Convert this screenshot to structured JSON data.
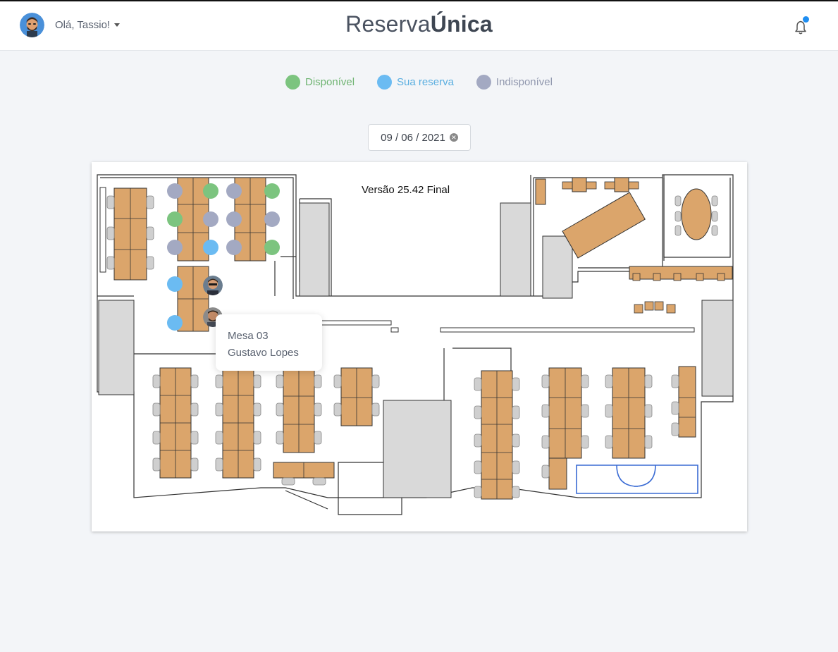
{
  "header": {
    "greeting": "Olá, Tassio!",
    "brand_regular": "Reserva",
    "brand_bold": "Única",
    "notification_icon": "bell-icon"
  },
  "legend": [
    {
      "label": "Disponível",
      "color": "#7cc47f",
      "text_color": "#6fb472"
    },
    {
      "label": "Sua reserva",
      "color": "#6bbbf2",
      "text_color": "#5aaee0"
    },
    {
      "label": "Indisponível",
      "color": "#a3a9c2",
      "text_color": "#8f96ad"
    }
  ],
  "date_picker": {
    "value": "09 / 06 / 2021",
    "clear_icon": "clear-circle-icon"
  },
  "floorplan": {
    "version_label": "Versão 25.42 Final",
    "seat_colors": {
      "available": "#7cc47f",
      "yours": "#6bbbf2",
      "unavailable": "#a3a9c2"
    }
  },
  "tooltip": {
    "desk": "Mesa 03",
    "person": "Gustavo Lopes"
  }
}
